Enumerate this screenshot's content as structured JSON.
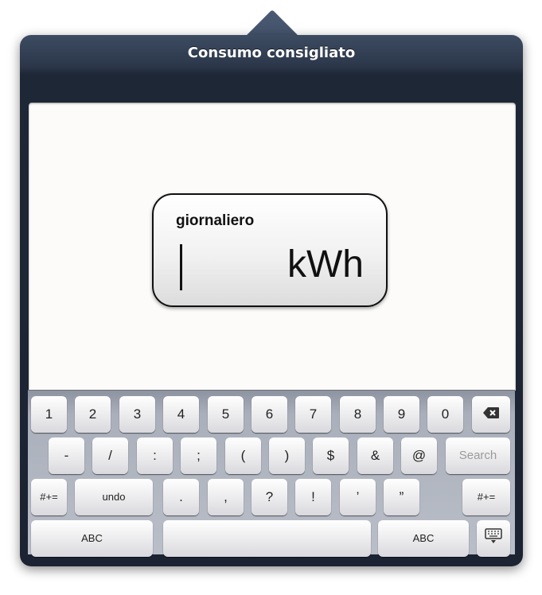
{
  "popover": {
    "title": "Consumo consigliato"
  },
  "field": {
    "label": "giornaliero",
    "value": "",
    "unit": "kWh"
  },
  "keyboard": {
    "row1": [
      "1",
      "2",
      "3",
      "4",
      "5",
      "6",
      "7",
      "8",
      "9",
      "0"
    ],
    "row2": [
      "-",
      "/",
      ":",
      ";",
      "(",
      ")",
      "$",
      "&",
      "@"
    ],
    "search_label": "Search",
    "row3_left": "#+=",
    "undo_label": "undo",
    "row3": [
      ".",
      ",",
      "?",
      "!",
      "’",
      "”"
    ],
    "row3_right": "#+=",
    "abc_left": "ABC",
    "abc_right": "ABC",
    "backspace_icon": "backspace-icon",
    "dismiss_icon": "keyboard-dismiss-icon"
  }
}
